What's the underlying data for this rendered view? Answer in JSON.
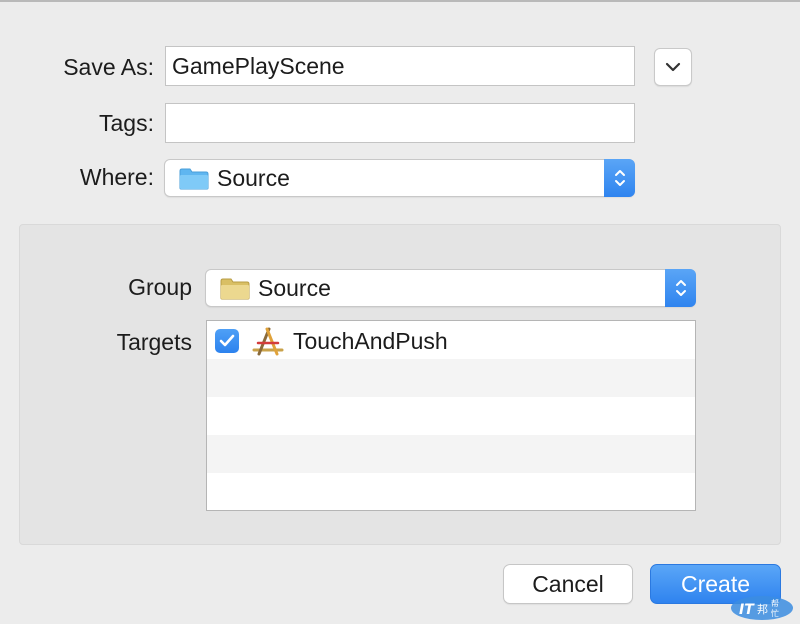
{
  "dialog": {
    "save_as": {
      "label": "Save As:",
      "value": "GamePlayScene"
    },
    "tags": {
      "label": "Tags:",
      "value": ""
    },
    "where": {
      "label": "Where:",
      "value": "Source"
    },
    "group": {
      "label": "Group",
      "value": "Source"
    },
    "targets": {
      "label": "Targets",
      "items": [
        {
          "name": "TouchAndPush",
          "checked": true
        }
      ]
    },
    "buttons": {
      "cancel": "Cancel",
      "create": "Create"
    }
  },
  "icons": {
    "disclosure": "chevron-down-icon",
    "where_folder": "blue-folder-icon",
    "group_folder": "yellow-folder-icon",
    "stepper": "up-down-chevron-icon",
    "target_app": "xcode-app-icon",
    "checkbox": "checkmark-icon"
  },
  "colors": {
    "accent": "#3b8ff1",
    "folder_blue": "#6cc0f4",
    "folder_yellow": "#e6cf7c",
    "window_bg": "#ececec",
    "panel_bg": "#e4e4e4"
  },
  "watermark": {
    "text": "IT邦帮忙"
  }
}
